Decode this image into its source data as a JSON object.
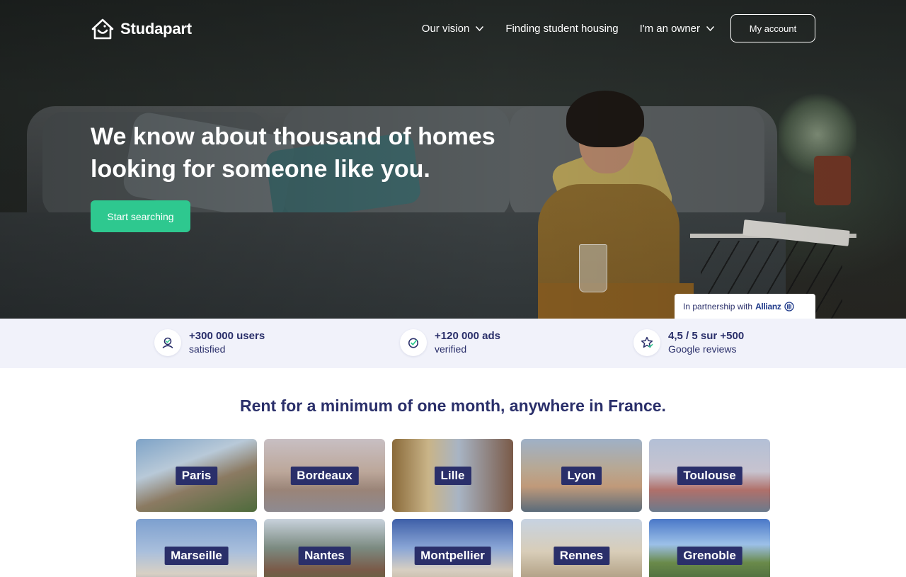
{
  "brand": {
    "name": "Studapart"
  },
  "nav": {
    "items": [
      {
        "label": "Our vision",
        "dropdown": true
      },
      {
        "label": "Finding student housing",
        "dropdown": false
      },
      {
        "label": "I'm an owner",
        "dropdown": true
      }
    ],
    "account_label": "My account"
  },
  "hero": {
    "title_line1": "We know about thousand of homes",
    "title_line2": "looking for someone like you.",
    "cta_label": "Start searching",
    "partner_text": "In partnership with",
    "partner_brand": "Allianz"
  },
  "stats": [
    {
      "title": "+300 000 users",
      "subtitle": "satisfied",
      "icon": "user-check-icon"
    },
    {
      "title": "+120 000 ads",
      "subtitle": "verified",
      "icon": "verified-check-icon"
    },
    {
      "title": "4,5 / 5 sur +500",
      "subtitle": "Google reviews",
      "icon": "star-icon"
    }
  ],
  "cities_section": {
    "title": "Rent for a minimum of one month, anywhere in France.",
    "cities": [
      {
        "name": "Paris"
      },
      {
        "name": "Bordeaux"
      },
      {
        "name": "Lille"
      },
      {
        "name": "Lyon"
      },
      {
        "name": "Toulouse"
      },
      {
        "name": "Marseille"
      },
      {
        "name": "Nantes"
      },
      {
        "name": "Montpellier"
      },
      {
        "name": "Rennes"
      },
      {
        "name": "Grenoble"
      }
    ]
  },
  "colors": {
    "primary": "#2a2f6a",
    "accent": "#2ec88f",
    "stats_bg": "#f1f2fa"
  }
}
